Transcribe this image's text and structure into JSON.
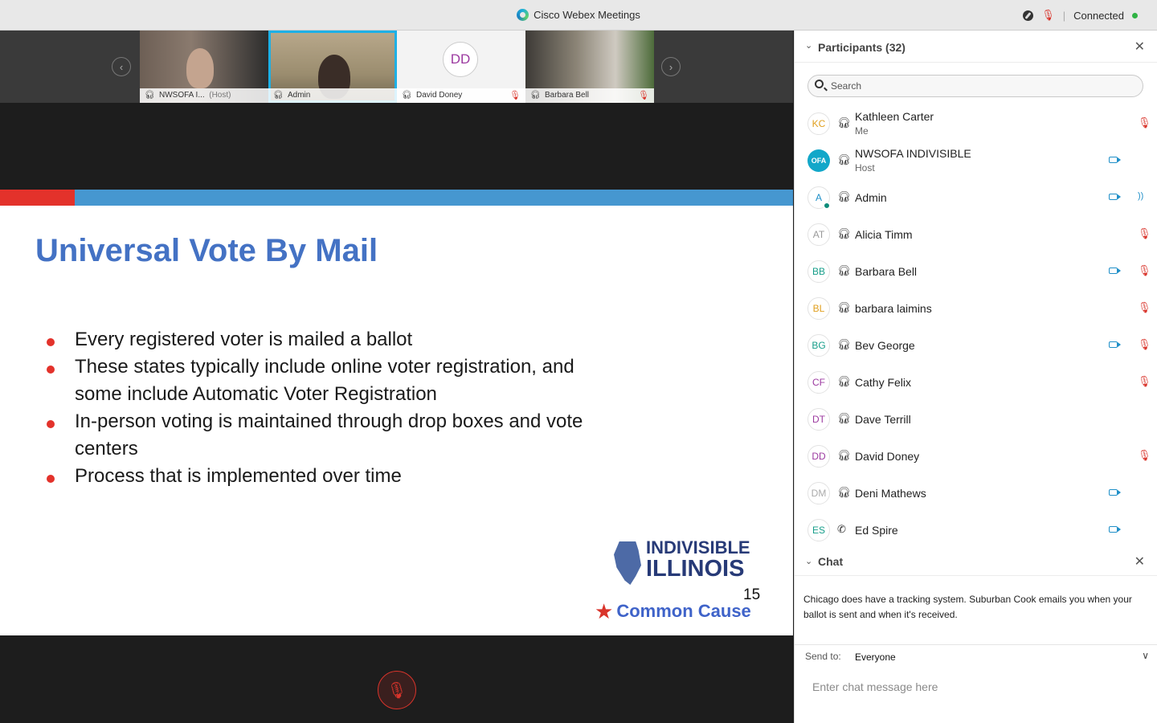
{
  "window": {
    "title": "Cisco Webex Meetings",
    "status": "Connected",
    "status_color": "#2fb344"
  },
  "filmstrip": {
    "prev_icon": "chevron-left-icon",
    "next_icon": "chevron-right-icon",
    "tiles": [
      {
        "name": "NWSOFA I...",
        "role": "(Host)",
        "muted": false,
        "active": false
      },
      {
        "name": "Admin",
        "role": "",
        "muted": false,
        "active": true
      },
      {
        "name": "David Doney",
        "role": "",
        "initials": "DD",
        "muted": true,
        "active": false
      },
      {
        "name": "Barbara Bell",
        "role": "",
        "muted": true,
        "active": false
      }
    ]
  },
  "slide": {
    "title": "Universal Vote By Mail",
    "bullets": [
      "Every registered voter is mailed a ballot",
      "These states typically include online voter registration, and some include Automatic Voter Registration",
      "In-person voting is maintained through drop boxes and vote centers",
      "Process that is implemented over time"
    ],
    "brand_line1": "INDIVISIBLE",
    "brand_line2": "ILLINOIS",
    "page_number": "15",
    "partner": "Common Cause",
    "accent_red": "#e3322b",
    "accent_blue": "#4697d0",
    "title_color": "#4472c4"
  },
  "participants": {
    "header": "Participants (32)",
    "search_placeholder": "Search",
    "list": [
      {
        "initials": "KC",
        "initials_color": "#e0a020",
        "name": "Kathleen Carter",
        "sub": "Me",
        "audio": "headset",
        "video": false,
        "muted": true,
        "speaking": false
      },
      {
        "initials": "OFA",
        "initials_color": "#ffffff",
        "name": "NWSOFA INDIVISIBLE",
        "sub": "Host",
        "audio": "headset",
        "video": true,
        "muted": false,
        "speaking": false
      },
      {
        "initials": "A",
        "initials_color": "#1f8fc8",
        "name": "Admin",
        "sub": "",
        "audio": "headset",
        "video": true,
        "muted": false,
        "speaking": true
      },
      {
        "initials": "AT",
        "initials_color": "#999999",
        "name": "Alicia Timm",
        "sub": "",
        "audio": "headset",
        "video": false,
        "muted": true,
        "speaking": false
      },
      {
        "initials": "BB",
        "initials_color": "#179e8a",
        "name": "Barbara Bell",
        "sub": "",
        "audio": "headset",
        "video": true,
        "muted": true,
        "speaking": false
      },
      {
        "initials": "BL",
        "initials_color": "#e0a020",
        "name": "barbara laimins",
        "sub": "",
        "audio": "headset",
        "video": false,
        "muted": true,
        "speaking": false
      },
      {
        "initials": "BG",
        "initials_color": "#179e8a",
        "name": "Bev George",
        "sub": "",
        "audio": "headset",
        "video": true,
        "muted": true,
        "speaking": false
      },
      {
        "initials": "CF",
        "initials_color": "#9c3aa0",
        "name": "Cathy Felix",
        "sub": "",
        "audio": "headset",
        "video": false,
        "muted": true,
        "speaking": false
      },
      {
        "initials": "DT",
        "initials_color": "#9c3aa0",
        "name": "Dave Terrill",
        "sub": "",
        "audio": "headset",
        "video": false,
        "muted": false,
        "speaking": false
      },
      {
        "initials": "DD",
        "initials_color": "#9c3aa0",
        "name": "David Doney",
        "sub": "",
        "audio": "headset",
        "video": false,
        "muted": true,
        "speaking": false
      },
      {
        "initials": "DM",
        "initials_color": "#aaaaaa",
        "name": "Deni Mathews",
        "sub": "",
        "audio": "headset",
        "video": true,
        "muted": false,
        "speaking": false
      },
      {
        "initials": "ES",
        "initials_color": "#179e8a",
        "name": "Ed Spire",
        "sub": "",
        "audio": "phone",
        "video": true,
        "muted": false,
        "speaking": false
      }
    ]
  },
  "chat": {
    "header": "Chat",
    "message": "Chicago does have a tracking system. Suburban Cook emails you when your ballot is sent and when it's received.",
    "send_to_label": "Send to:",
    "send_to_value": "Everyone",
    "input_placeholder": "Enter chat message here"
  }
}
